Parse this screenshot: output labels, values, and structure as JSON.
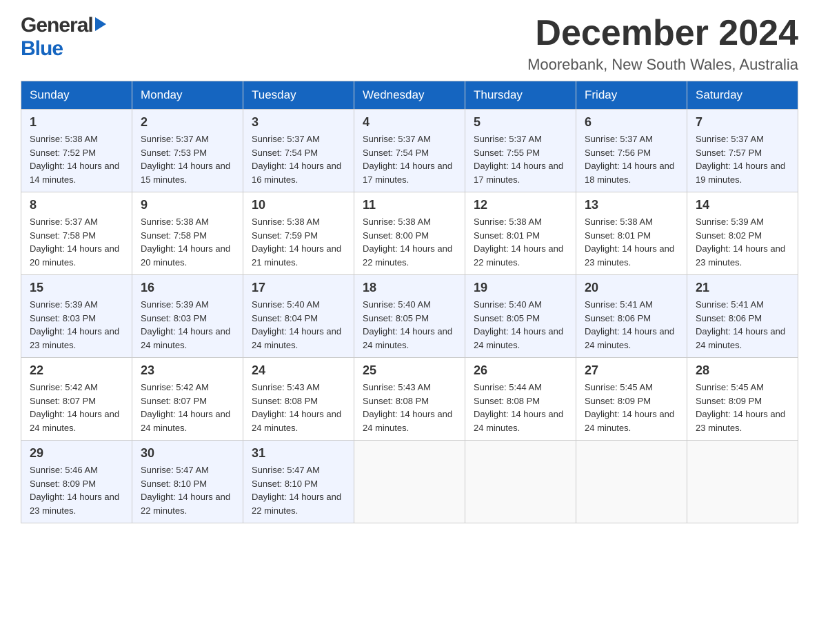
{
  "header": {
    "logo_general": "General",
    "logo_blue": "Blue",
    "month_title": "December 2024",
    "location": "Moorebank, New South Wales, Australia"
  },
  "days_of_week": [
    "Sunday",
    "Monday",
    "Tuesday",
    "Wednesday",
    "Thursday",
    "Friday",
    "Saturday"
  ],
  "weeks": [
    [
      {
        "day": "1",
        "sunrise": "5:38 AM",
        "sunset": "7:52 PM",
        "daylight": "14 hours and 14 minutes."
      },
      {
        "day": "2",
        "sunrise": "5:37 AM",
        "sunset": "7:53 PM",
        "daylight": "14 hours and 15 minutes."
      },
      {
        "day": "3",
        "sunrise": "5:37 AM",
        "sunset": "7:54 PM",
        "daylight": "14 hours and 16 minutes."
      },
      {
        "day": "4",
        "sunrise": "5:37 AM",
        "sunset": "7:54 PM",
        "daylight": "14 hours and 17 minutes."
      },
      {
        "day": "5",
        "sunrise": "5:37 AM",
        "sunset": "7:55 PM",
        "daylight": "14 hours and 17 minutes."
      },
      {
        "day": "6",
        "sunrise": "5:37 AM",
        "sunset": "7:56 PM",
        "daylight": "14 hours and 18 minutes."
      },
      {
        "day": "7",
        "sunrise": "5:37 AM",
        "sunset": "7:57 PM",
        "daylight": "14 hours and 19 minutes."
      }
    ],
    [
      {
        "day": "8",
        "sunrise": "5:37 AM",
        "sunset": "7:58 PM",
        "daylight": "14 hours and 20 minutes."
      },
      {
        "day": "9",
        "sunrise": "5:38 AM",
        "sunset": "7:58 PM",
        "daylight": "14 hours and 20 minutes."
      },
      {
        "day": "10",
        "sunrise": "5:38 AM",
        "sunset": "7:59 PM",
        "daylight": "14 hours and 21 minutes."
      },
      {
        "day": "11",
        "sunrise": "5:38 AM",
        "sunset": "8:00 PM",
        "daylight": "14 hours and 22 minutes."
      },
      {
        "day": "12",
        "sunrise": "5:38 AM",
        "sunset": "8:01 PM",
        "daylight": "14 hours and 22 minutes."
      },
      {
        "day": "13",
        "sunrise": "5:38 AM",
        "sunset": "8:01 PM",
        "daylight": "14 hours and 23 minutes."
      },
      {
        "day": "14",
        "sunrise": "5:39 AM",
        "sunset": "8:02 PM",
        "daylight": "14 hours and 23 minutes."
      }
    ],
    [
      {
        "day": "15",
        "sunrise": "5:39 AM",
        "sunset": "8:03 PM",
        "daylight": "14 hours and 23 minutes."
      },
      {
        "day": "16",
        "sunrise": "5:39 AM",
        "sunset": "8:03 PM",
        "daylight": "14 hours and 24 minutes."
      },
      {
        "day": "17",
        "sunrise": "5:40 AM",
        "sunset": "8:04 PM",
        "daylight": "14 hours and 24 minutes."
      },
      {
        "day": "18",
        "sunrise": "5:40 AM",
        "sunset": "8:05 PM",
        "daylight": "14 hours and 24 minutes."
      },
      {
        "day": "19",
        "sunrise": "5:40 AM",
        "sunset": "8:05 PM",
        "daylight": "14 hours and 24 minutes."
      },
      {
        "day": "20",
        "sunrise": "5:41 AM",
        "sunset": "8:06 PM",
        "daylight": "14 hours and 24 minutes."
      },
      {
        "day": "21",
        "sunrise": "5:41 AM",
        "sunset": "8:06 PM",
        "daylight": "14 hours and 24 minutes."
      }
    ],
    [
      {
        "day": "22",
        "sunrise": "5:42 AM",
        "sunset": "8:07 PM",
        "daylight": "14 hours and 24 minutes."
      },
      {
        "day": "23",
        "sunrise": "5:42 AM",
        "sunset": "8:07 PM",
        "daylight": "14 hours and 24 minutes."
      },
      {
        "day": "24",
        "sunrise": "5:43 AM",
        "sunset": "8:08 PM",
        "daylight": "14 hours and 24 minutes."
      },
      {
        "day": "25",
        "sunrise": "5:43 AM",
        "sunset": "8:08 PM",
        "daylight": "14 hours and 24 minutes."
      },
      {
        "day": "26",
        "sunrise": "5:44 AM",
        "sunset": "8:08 PM",
        "daylight": "14 hours and 24 minutes."
      },
      {
        "day": "27",
        "sunrise": "5:45 AM",
        "sunset": "8:09 PM",
        "daylight": "14 hours and 24 minutes."
      },
      {
        "day": "28",
        "sunrise": "5:45 AM",
        "sunset": "8:09 PM",
        "daylight": "14 hours and 23 minutes."
      }
    ],
    [
      {
        "day": "29",
        "sunrise": "5:46 AM",
        "sunset": "8:09 PM",
        "daylight": "14 hours and 23 minutes."
      },
      {
        "day": "30",
        "sunrise": "5:47 AM",
        "sunset": "8:10 PM",
        "daylight": "14 hours and 22 minutes."
      },
      {
        "day": "31",
        "sunrise": "5:47 AM",
        "sunset": "8:10 PM",
        "daylight": "14 hours and 22 minutes."
      },
      null,
      null,
      null,
      null
    ]
  ],
  "labels": {
    "sunrise": "Sunrise:",
    "sunset": "Sunset:",
    "daylight": "Daylight:"
  }
}
